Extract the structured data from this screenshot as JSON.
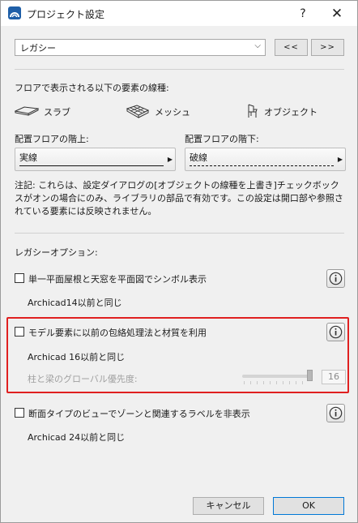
{
  "window": {
    "title": "プロジェクト設定",
    "help_label": "?",
    "close_label": "✕"
  },
  "preset": {
    "selected": "レガシー",
    "prev_label": "<<",
    "next_label": ">>"
  },
  "line_section": {
    "heading": "フロアで表示される以下の要素の線種:",
    "elements": [
      {
        "label": "スラブ",
        "icon": "slab-icon"
      },
      {
        "label": "メッシュ",
        "icon": "mesh-icon"
      },
      {
        "label": "オブジェクト",
        "icon": "object-chair-icon"
      }
    ],
    "above_label": "配置フロアの階上:",
    "above_value": "実線",
    "below_label": "配置フロアの階下:",
    "below_value": "破線",
    "note": "注記: これらは、設定ダイアログの[オブジェクトの線種を上書き]チェックボックスがオンの場合にのみ、ライブラリの部品で有効です。この設定は開口部や参照されている要素には反映されません。"
  },
  "legacy": {
    "heading": "レガシーオプション:",
    "options": [
      {
        "label": "単一平面屋根と天窓を平面図でシンボル表示",
        "checked": false,
        "compat": "Archicad14以前と同じ"
      },
      {
        "label": "モデル要素に以前の包絡処理法と材質を利用",
        "checked": false,
        "compat": "Archicad 16以前と同じ",
        "priority_label": "柱と梁のグローバル優先度:",
        "priority_value": "16",
        "priority_fraction": 1.0
      },
      {
        "label": "断面タイプのビューでゾーンと関連するラベルを非表示",
        "checked": false,
        "compat": "Archicad 24以前と同じ"
      }
    ]
  },
  "footer": {
    "cancel_label": "キャンセル",
    "ok_label": "OK"
  },
  "colors": {
    "highlight": "#e02020",
    "accent": "#0078d7"
  }
}
